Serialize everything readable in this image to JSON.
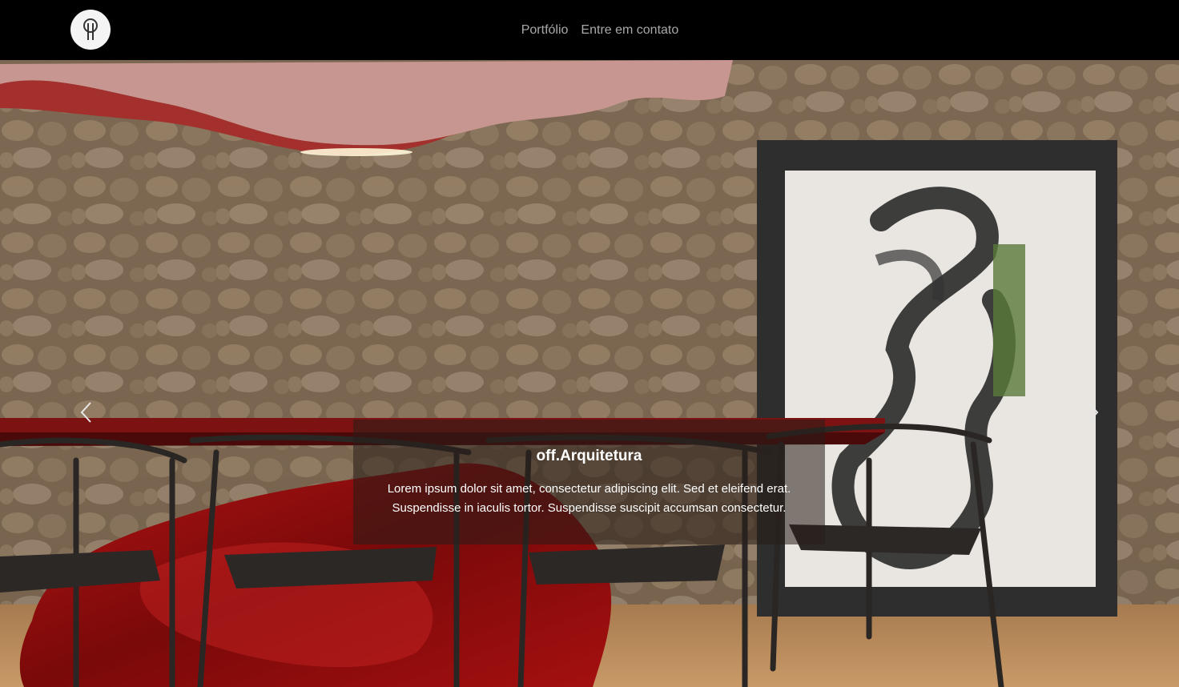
{
  "navbar": {
    "logo_icon": "pin-logo-icon",
    "links": [
      {
        "label": "Portfólio"
      },
      {
        "label": "Entre em contato"
      }
    ]
  },
  "hero": {
    "caption": {
      "title": "off.Arquitetura",
      "text": "Lorem ipsum dolor sit amet, consectetur adipiscing elit. Sed et eleifend erat. Suspendisse in iaculis tortor. Suspendisse suscipit accumsan consectetur."
    },
    "prev_icon": "chevron-left-icon",
    "next_icon": "chevron-right-icon"
  },
  "colors": {
    "navbar_bg": "#000000",
    "nav_link": "#a9a9a9",
    "wall": "#7a6650",
    "table_red": "#8e0d0d",
    "floor": "#b88a5a"
  }
}
